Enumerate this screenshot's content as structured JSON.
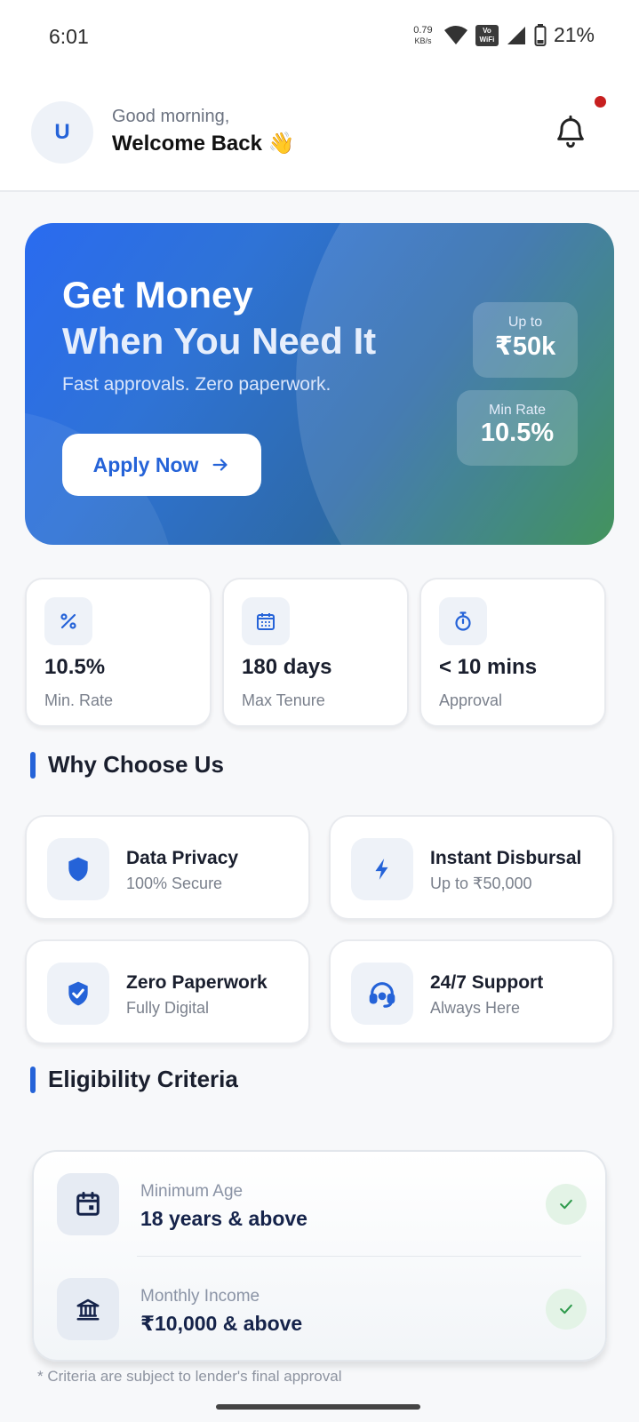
{
  "status_bar": {
    "time": "6:01",
    "net_speed": "0.79",
    "net_unit": "KB/s",
    "vowifi": "Vo WiFi",
    "battery": "21%"
  },
  "header": {
    "avatar_initial": "U",
    "greeting": "Good morning,",
    "welcome": "Welcome Back 👋"
  },
  "hero": {
    "title_line1": "Get Money",
    "title_line2": "When You Need It",
    "subtitle": "Fast approvals. Zero paperwork.",
    "apply_label": "Apply Now",
    "upto_label": "Up to",
    "upto_value": "₹50k",
    "minrate_label": "Min Rate",
    "minrate_value": "10.5%"
  },
  "quick_stats": [
    {
      "value": "10.5%",
      "label": "Min. Rate",
      "icon": "percent-icon"
    },
    {
      "value": "180 days",
      "label": "Max Tenure",
      "icon": "calendar-icon"
    },
    {
      "value": "< 10 mins",
      "label": "Approval",
      "icon": "stopwatch-icon"
    }
  ],
  "why": {
    "title": "Why Choose Us",
    "items": [
      {
        "title": "Data Privacy",
        "sub": "100% Secure",
        "icon": "shield-icon"
      },
      {
        "title": "Instant Disbursal",
        "sub": "Up to ₹50,000",
        "icon": "lightning-icon"
      },
      {
        "title": "Zero Paperwork",
        "sub": "Fully Digital",
        "icon": "verified-shield-icon"
      },
      {
        "title": "24/7 Support",
        "sub": "Always Here",
        "icon": "headset-icon"
      }
    ]
  },
  "eligibility": {
    "title": "Eligibility Criteria",
    "items": [
      {
        "label": "Minimum Age",
        "value": "18 years & above",
        "icon": "calendar-icon"
      },
      {
        "label": "Monthly Income",
        "value": "₹10,000 & above",
        "icon": "bank-icon"
      }
    ],
    "footnote": "* Criteria are subject to lender's final approval"
  },
  "colors": {
    "accent": "#2563d8",
    "check_green": "#2e9a4c",
    "notification": "#c71f1f"
  }
}
